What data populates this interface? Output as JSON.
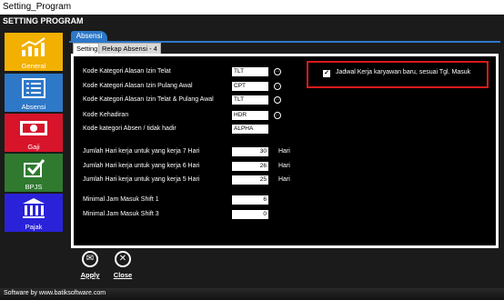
{
  "window": {
    "title": "Setting_Program"
  },
  "app": {
    "header": "SETTING PROGRAM"
  },
  "sidebar": {
    "items": [
      {
        "label": "General",
        "icon": "chart-icon"
      },
      {
        "label": "Absensi",
        "icon": "list-icon"
      },
      {
        "label": "Gaji",
        "icon": "money-icon"
      },
      {
        "label": "BPJS",
        "icon": "checkbox-icon"
      },
      {
        "label": "Pajak",
        "icon": "building-icon"
      }
    ]
  },
  "tabs": {
    "main": "Absensi",
    "sub": [
      "Setting",
      "Rekap Absensi - 4"
    ]
  },
  "form": {
    "codes": [
      {
        "label": "Kode Kategori Alasan Izin Telat",
        "value": "TLT"
      },
      {
        "label": "Kode Kategori Alasan Izin Pulang Awal",
        "value": "CPT"
      },
      {
        "label": "Kode Kategori Alasan Izin Telat & Pulang Awal",
        "value": "TLT"
      },
      {
        "label": "Kode Kehadiran",
        "value": "HDR"
      },
      {
        "label": "Kode kategori Absen / tidak hadir",
        "value": "ALPHA"
      }
    ],
    "workdays": [
      {
        "label": "Jumlah Hari kerja untuk yang kerja 7 Hari",
        "value": "30",
        "unit": "Hari"
      },
      {
        "label": "Jumlah Hari kerja untuk yang kerja 6 Hari",
        "value": "26",
        "unit": "Hari"
      },
      {
        "label": "Jumlah Hari kerja untuk yang kerja 5 Hari",
        "value": "25",
        "unit": "Hari"
      }
    ],
    "shifts": [
      {
        "label": "Minimal Jam Masuk Shift 1",
        "value": "6"
      },
      {
        "label": "Minimal Jam Masuk Shift 3",
        "value": "0"
      }
    ],
    "checkbox": {
      "label": "Jadwal Kerja karyawan baru, sesuai Tgl. Masuk",
      "checked": true
    }
  },
  "buttons": {
    "apply": "Apply",
    "close": "Close"
  },
  "footer": {
    "text": "Software by www.batiksoftware.com"
  },
  "colors": {
    "general": "#f2b000",
    "absensi": "#2e78c8",
    "gaji": "#d7142a",
    "bpjs": "#2f7a2f",
    "pajak": "#2a22d8",
    "highlight": "#d81a1a"
  }
}
